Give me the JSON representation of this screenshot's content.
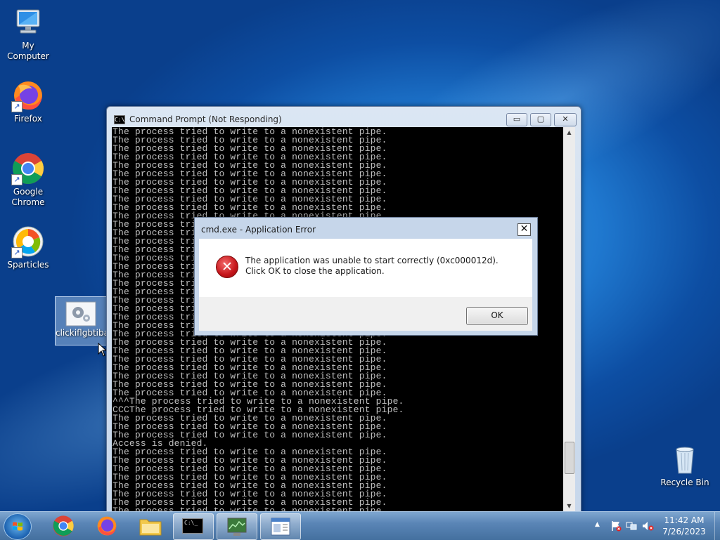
{
  "desktop": {
    "icons": [
      {
        "label": "My Computer",
        "icon": "computer-icon"
      },
      {
        "label": "Firefox",
        "icon": "firefox-icon"
      },
      {
        "label": "Google Chrome",
        "icon": "chrome-icon"
      },
      {
        "label": "Sparticles",
        "icon": "sparticles-icon"
      },
      {
        "label": "clickiflgbtiba",
        "icon": "settings-file-icon"
      },
      {
        "label": "Recycle Bin",
        "icon": "recycle-bin-icon"
      }
    ]
  },
  "cmd_window": {
    "title": "Command Prompt (Not Responding)",
    "minimize": "▭",
    "maximize": "▢",
    "close": "✕",
    "console_lines": [
      "The process tried to write to a nonexistent pipe.",
      "The process tried to write to a nonexistent pipe.",
      "The process tried to write to a nonexistent pipe.",
      "The process tried to write to a nonexistent pipe.",
      "The process tried to write to a nonexistent pipe.",
      "The process tried to write to a nonexistent pipe.",
      "The process tried to write to a nonexistent pipe.",
      "The process tried to write to a nonexistent pipe.",
      "The process tried to write to a nonexistent pipe.",
      "The process tried to write to a nonexistent pipe.",
      "The process tried to write to a nonexistent pipe.",
      "The process tried to write to a nonexistent pipe.",
      "The process tried to write to a nonexistent pipe.",
      "The process tried to write to a nonexistent pipe.",
      "The process tried to write to a nonexistent pipe.",
      "The process tried to write to a nonexistent pipe.",
      "The process tried to write to a nonexistent pipe.",
      "The process tried to write to a nonexistent pipe.",
      "The process tried to write to a nonexistent pipe.",
      "The process tried to write to a nonexistent pipe.",
      "The process tried to write to a nonexistent pipe.",
      "The process tried to write to a nonexistent pipe.",
      "The process tried to write to a nonexistent pipe.",
      "The process tried to write to a nonexistent pipe.",
      "The process tried to write to a nonexistent pipe.",
      "The process tried to write to a nonexistent pipe.",
      "The process tried to write to a nonexistent pipe.",
      "The process tried to write to a nonexistent pipe.",
      "The process tried to write to a nonexistent pipe.",
      "The process tried to write to a nonexistent pipe.",
      "The process tried to write to a nonexistent pipe.",
      "The process tried to write to a nonexistent pipe.",
      "^^^The process tried to write to a nonexistent pipe.",
      "CCCThe process tried to write to a nonexistent pipe.",
      "The process tried to write to a nonexistent pipe.",
      "The process tried to write to a nonexistent pipe.",
      "The process tried to write to a nonexistent pipe.",
      "Access is denied.",
      "The process tried to write to a nonexistent pipe.",
      "The process tried to write to a nonexistent pipe.",
      "The process tried to write to a nonexistent pipe.",
      "The process tried to write to a nonexistent pipe.",
      "The process tried to write to a nonexistent pipe.",
      "The process tried to write to a nonexistent pipe.",
      "The process tried to write to a nonexistent pipe.",
      "The process tried to write to a nonexistent pipe.",
      "The process tried to write to a nonexistent pipe."
    ],
    "scrollbar_position": 0.92
  },
  "error_dialog": {
    "title": "cmd.exe - Application Error",
    "close": "✕",
    "icon": "error-icon",
    "icon_glyph": "✕",
    "message": "The application was unable to start correctly (0xc000012d). Click OK to close the application.",
    "ok_label": "OK"
  },
  "taskbar": {
    "pinned": [
      {
        "name": "chrome",
        "icon": "chrome-icon"
      },
      {
        "name": "firefox",
        "icon": "firefox-icon"
      },
      {
        "name": "explorer",
        "icon": "folder-icon"
      },
      {
        "name": "cmd",
        "icon": "cmd-icon"
      },
      {
        "name": "system-monitor",
        "icon": "monitor-icon"
      },
      {
        "name": "app-window",
        "icon": "window-icon"
      }
    ],
    "tray": {
      "show_hidden": "▲",
      "icons": [
        "flag-icon",
        "network-icon",
        "volume-muted-icon"
      ]
    },
    "clock": {
      "time": "11:42 AM",
      "date": "7/26/2023"
    }
  },
  "colors": {
    "desktop_blue": "#1f78cf",
    "console_bg": "#000000",
    "console_text": "#c0c0c0",
    "error_red": "#c5151a"
  }
}
